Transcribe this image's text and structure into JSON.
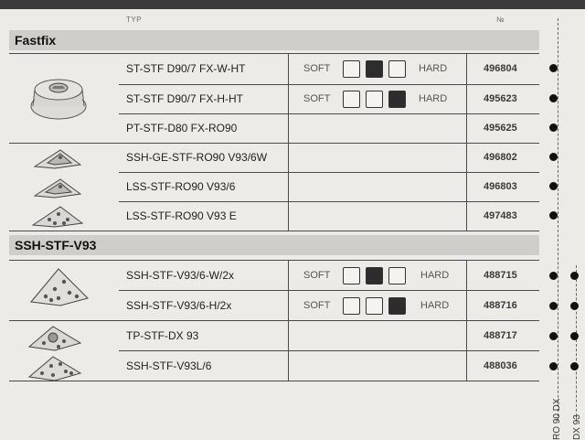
{
  "header": {
    "type_label": "TYP",
    "number_label": "№"
  },
  "sections": {
    "fastfix": "Fastfix",
    "ssh": "SSH-STF-V93"
  },
  "hardness": {
    "soft": "SOFT",
    "hard": "HARD"
  },
  "rows": [
    {
      "type": "ST-STF D90/7 FX-W-HT",
      "number": "496804",
      "level": "medium"
    },
    {
      "type": "ST-STF D90/7 FX-H-HT",
      "number": "495623",
      "level": "hard"
    },
    {
      "type": "PT-STF-D80 FX-RO90",
      "number": "495625"
    },
    {
      "type": "SSH-GE-STF-RO90 V93/6W",
      "number": "496802"
    },
    {
      "type": "LSS-STF-RO90 V93/6",
      "number": "496803"
    },
    {
      "type": "LSS-STF-RO90 V93 E",
      "number": "497483"
    },
    {
      "type": "SSH-STF-V93/6-W/2x",
      "number": "488715",
      "level": "medium"
    },
    {
      "type": "SSH-STF-V93/6-H/2x",
      "number": "488716",
      "level": "hard"
    },
    {
      "type": "TP-STF-DX 93",
      "number": "488717"
    },
    {
      "type": "SSH-STF-V93L/6",
      "number": "488036"
    }
  ],
  "columns": {
    "col1": "RO 90 DX",
    "col2": "DX 93"
  }
}
